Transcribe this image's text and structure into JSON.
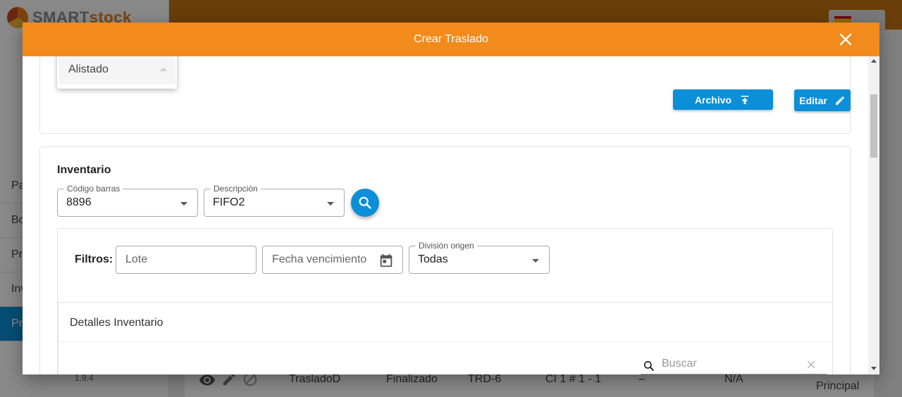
{
  "background": {
    "logo_text_gray": "SMART",
    "logo_text_orange": "stock",
    "sidebar_items": [
      "Pa",
      "Bo",
      "Pr",
      "Inv",
      "Pr"
    ],
    "version": "1.9.4",
    "table_row": {
      "name": "TrasladoD",
      "status": "Finalizado",
      "code": "TRD-6",
      "location": "CI 1 # 1 - 1",
      "dash": "–",
      "na": "N/A",
      "division": "Principal"
    }
  },
  "modal": {
    "title": "Crear Traslado",
    "estado": {
      "selected": "Alistado"
    },
    "buttons": {
      "archivo": "Archivo",
      "editar": "Editar"
    },
    "inventario": {
      "title": "Inventario",
      "codigo_barras": {
        "label": "Código barras",
        "value": "8896"
      },
      "descripcion": {
        "label": "Descripción",
        "value": "FIFO2"
      },
      "filtros": {
        "label": "Filtros:",
        "lote_placeholder": "Lote",
        "fecha_placeholder": "Fecha vencimiento",
        "division": {
          "label": "División origen",
          "value": "Todas"
        }
      },
      "detalles": {
        "title": "Detalles Inventario",
        "search_placeholder": "Buscar"
      }
    }
  },
  "colors": {
    "header_orange": "#f38a1c",
    "primary_blue": "#0a8fd8"
  }
}
